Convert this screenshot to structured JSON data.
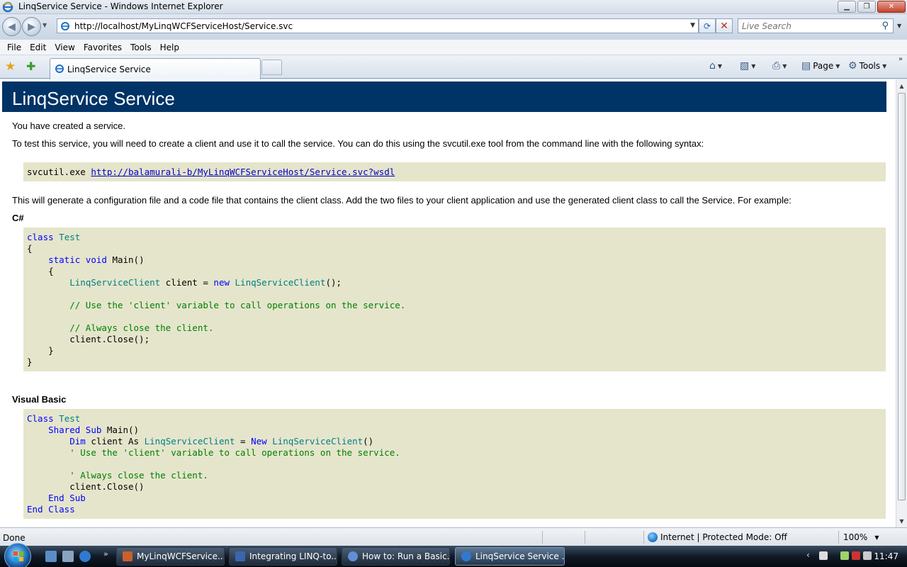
{
  "window": {
    "title": "LinqService Service - Windows Internet Explorer",
    "min_label": "▁",
    "max_label": "❐",
    "close_label": "✕"
  },
  "address_bar": {
    "url": "http://localhost/MyLinqWCFServiceHost/Service.svc",
    "search_placeholder": "Live Search"
  },
  "menu": [
    "File",
    "Edit",
    "View",
    "Favorites",
    "Tools",
    "Help"
  ],
  "tabs": {
    "active_label": "LinqService Service"
  },
  "command_bar": {
    "page_label": "Page",
    "tools_label": "Tools"
  },
  "page": {
    "heading": "LinqService Service",
    "intro": "You have created a service.",
    "test_instructions": "To test this service, you will need to create a client and use it to call the service. You can do this using the svcutil.exe tool from the command line with the following syntax:",
    "svcutil_cmd": "svcutil.exe ",
    "wsdl_link": "http://balamurali-b/MyLinqWCFServiceHost/Service.svc?wsdl",
    "generate_text": "This will generate a configuration file and a code file that contains the client class. Add the two files to your client application and use the generated client class to call the Service. For example:",
    "csharp_label": "C#",
    "vb_label": "Visual Basic",
    "cs": {
      "class": "class",
      "test": "Test",
      "static": "static",
      "void": "void",
      "main": "Main()",
      "client_type": "LinqServiceClient",
      "client_var": " client = ",
      "new": "new",
      "ctor": "LinqServiceClient",
      "ctor_end": "();",
      "comment1": "// Use the 'client' variable to call operations on the service.",
      "comment2": "// Always close the client.",
      "close_call": "client.Close();",
      "open_brace": "{",
      "close_brace": "}"
    },
    "vb": {
      "class": "Class",
      "test": "Test",
      "shared": "Shared",
      "sub": "Sub",
      "main": "Main()",
      "dim": "Dim",
      "client_as": " client As ",
      "client_type": "LinqServiceClient",
      "eq": " = ",
      "new": "New",
      "ctor": "LinqServiceClient",
      "ctor_end": "()",
      "comment1": "' Use the 'client' variable to call operations on the service.",
      "comment2": "' Always close the client.",
      "close_call": "client.Close()",
      "end_sub": "End Sub",
      "end_class": "End Class"
    }
  },
  "status_bar": {
    "status": "Done",
    "zone": "Internet | Protected Mode: Off",
    "zoom": "100%"
  },
  "taskbar": {
    "tasks": [
      "MyLinqWCFService...",
      "Integrating LINQ-to...",
      "How to: Run a Basic...",
      "LinqService Service ..."
    ],
    "clock": "11:47"
  },
  "colors": {
    "hero_bg": "#003366",
    "code_bg": "#e5e5cc",
    "keyword": "#0000ff",
    "type": "#008080",
    "comment": "#008000",
    "link": "#0000cc"
  }
}
